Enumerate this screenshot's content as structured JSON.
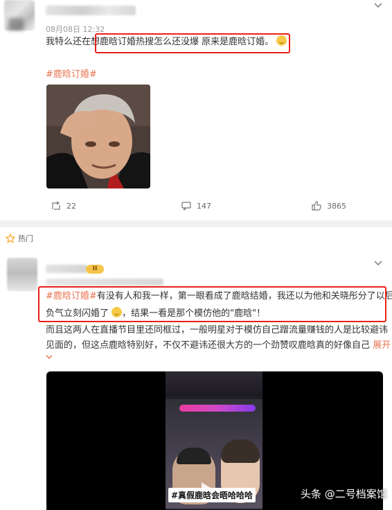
{
  "post1": {
    "date": "08月08日 12:32",
    "text_before": "我特么还在想",
    "text_highlighted": "鹿晗订婚热搜怎么还没爆 原来是鹿晗订婚。",
    "hashtag": "#鹿晗订婚#",
    "repost_count": "22",
    "comment_count": "147",
    "like_count": "3865"
  },
  "section": {
    "hot_label": "热门"
  },
  "post2": {
    "vip_badge": "II",
    "line1_tag": "#鹿晗订婚#",
    "line1_rest": "有没有人和我一样，第一眼看成了鹿晗结婚，我还以为他和关晓彤分了以后",
    "line2_a": "负气立刻闪婚了",
    "line2_b": "，结果一看是那个模仿他的\"鹿晗\"！",
    "line3": "而且这两人在直播节目里还同框过，一般明星对于模仿自己蹭流量赚钱的人是比较避讳",
    "line4": "见面的，但这点鹿晗特别好，不仅不避讳还很大方的一个劲赞叹鹿晗真的好像自己",
    "expand": "展开",
    "video_caption": "#真假鹿晗会晤哈哈哈"
  },
  "watermark": "头条 @二号档案馆",
  "colors": {
    "accent": "#eb7350",
    "highlight_border": "#e8201a",
    "separator": "#f2f2f2"
  }
}
